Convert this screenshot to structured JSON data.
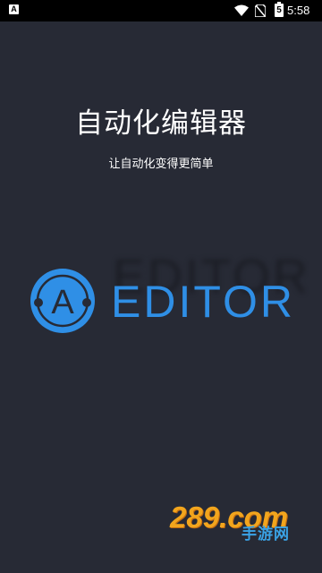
{
  "status_bar": {
    "notification_icon": "A",
    "battery_level": "5",
    "time": "5:58",
    "icons": [
      "notification-icon",
      "wifi-icon",
      "no-sim-icon",
      "battery-icon"
    ]
  },
  "splash": {
    "title": "自动化编辑器",
    "subtitle": "让自动化变得更简单"
  },
  "logo": {
    "letter": "A",
    "wordmark": "EDITOR",
    "color": "#2f8fe6"
  },
  "watermark": {
    "main": "289.com",
    "sub": "手游网",
    "colors": {
      "main": "#f2a51d",
      "sub": "#3aa3e6"
    }
  },
  "colors": {
    "background": "#272a35",
    "status_bar": "#000000"
  }
}
